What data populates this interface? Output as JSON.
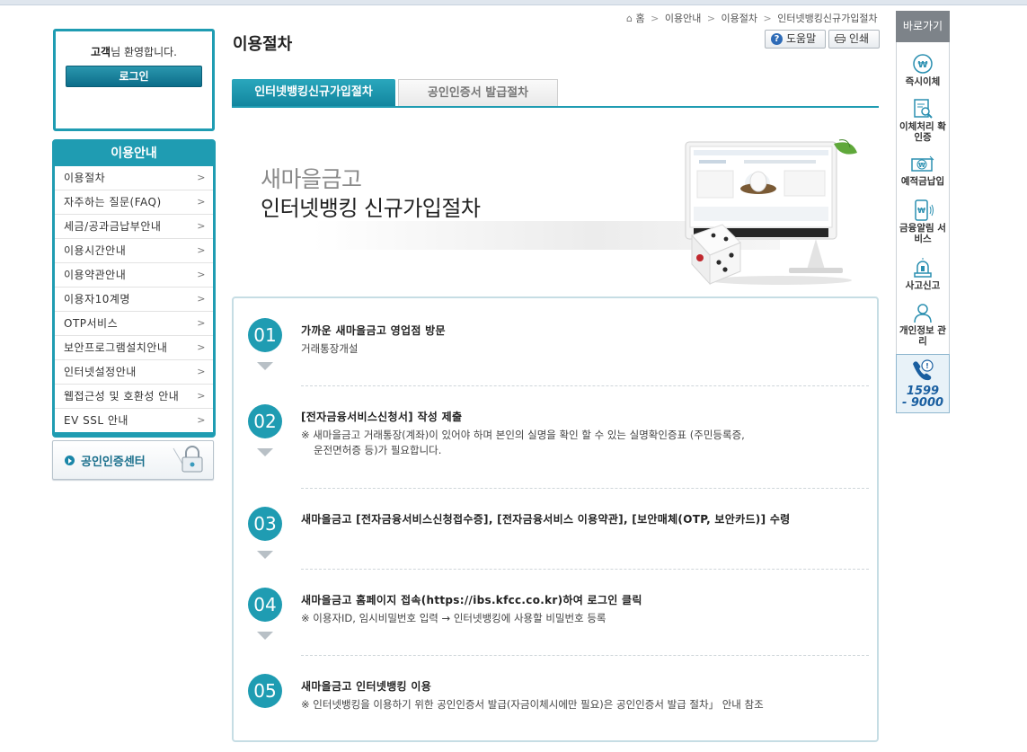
{
  "welcome": {
    "name": "고객",
    "suffix": "님 환영합니다.",
    "login_label": "로그인"
  },
  "menu": {
    "title": "이용안내",
    "items": [
      {
        "label": "이용절차"
      },
      {
        "label": "자주하는 질문(FAQ)"
      },
      {
        "label": "세금/공과금납부안내"
      },
      {
        "label": "이용시간안내"
      },
      {
        "label": "이용약관안내"
      },
      {
        "label": "이용자10계명"
      },
      {
        "label": "OTP서비스"
      },
      {
        "label": "보안프로그램설치안내"
      },
      {
        "label": "인터넷설정안내"
      },
      {
        "label": "웹접근성 및 호환성 안내"
      },
      {
        "label": "EV SSL 안내"
      }
    ],
    "chevron": ">"
  },
  "cert_center": {
    "label": "공인인증센터"
  },
  "breadcrumb": {
    "home": "홈",
    "items": [
      "이용안내",
      "이용절차",
      "인터넷뱅킹신규가입절차"
    ],
    "separator": ">"
  },
  "page": {
    "title": "이용절차",
    "help_label": "도움말",
    "print_label": "인쇄"
  },
  "tabs": [
    {
      "label": "인터넷뱅킹신규가입절차"
    },
    {
      "label": "공인인증서 발급절차"
    }
  ],
  "banner": {
    "subtitle": "새마을금고",
    "title": "인터넷뱅킹 신규가입절차"
  },
  "steps": [
    {
      "num": "01",
      "head": "가까운 새마을금고 영업점 방문",
      "desc": "거래통장개설",
      "desc2": ""
    },
    {
      "num": "02",
      "head": "[전자금융서비스신청서] 작성 제출",
      "desc": "※ 새마을금고 거래통장(계좌)이 있어야 하며 본인의 실명을 확인 할 수 있는 실명확인증표 (주민등록증,",
      "desc2": "운전면허증 등)가 필요합니다."
    },
    {
      "num": "03",
      "head": "새마을금고 [전자금융서비스신청접수증], [전자금융서비스 이용약관], [보안매체(OTP, 보안카드)] 수령",
      "desc": "",
      "desc2": ""
    },
    {
      "num": "04",
      "head": "새마을금고 홈페이지 접속(https://ibs.kfcc.co.kr)하여 로그인 클릭",
      "desc": "※ 이용자ID, 임시비밀번호 입력 → 인터넷뱅킹에 사용할 비밀번호 등록",
      "desc2": ""
    },
    {
      "num": "05",
      "head": "새마을금고 인터넷뱅킹 이용",
      "desc": "※ 인터넷뱅킹을 이용하기 위한 공인인증서 발급(자금이체시에만 필요)은 공인인증서 발급 절차」 안내 참조",
      "desc2": ""
    }
  ],
  "quickbar": {
    "title": "바로가기",
    "items": [
      {
        "label": "즉시이체",
        "icon": "won-circle-icon"
      },
      {
        "label": "이체처리 확인증",
        "icon": "document-search-icon"
      },
      {
        "label": "예적금납입",
        "icon": "won-bill-icon"
      },
      {
        "label": "금융알림 서비스",
        "icon": "phone-alert-icon"
      },
      {
        "label": "사고신고",
        "icon": "siren-icon"
      },
      {
        "label": "개인정보 관리",
        "icon": "person-icon"
      }
    ],
    "call_number_1": "1599",
    "call_number_2": "- 9000"
  },
  "colors": {
    "accent": "#1f9cb2",
    "quickbar_head": "#7d8389"
  }
}
